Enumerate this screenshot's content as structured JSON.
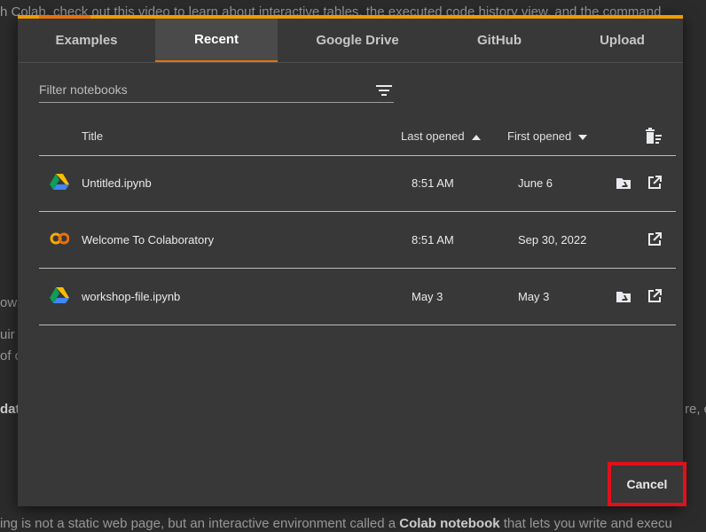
{
  "background": {
    "top_text": "h Colab, check out this video to learn about interactive tables, the executed code history view, and the command",
    "fragments": [
      "ows",
      "uir",
      "of c",
      "dat",
      "re, c"
    ],
    "bottom_text_pre": "ing is not a static web page, but an interactive environment called a ",
    "bottom_text_bold": "Colab notebook",
    "bottom_text_post": " that lets you write and execu"
  },
  "dialog": {
    "tabs": [
      "Examples",
      "Recent",
      "Google Drive",
      "GitHub",
      "Upload"
    ],
    "active_tab": "Recent",
    "filter_placeholder": "Filter notebooks",
    "table": {
      "headers": {
        "title": "Title",
        "last_opened": "Last opened",
        "first_opened": "First opened"
      },
      "rows": [
        {
          "icon": "google-drive-icon",
          "title": "Untitled.ipynb",
          "last_opened": "8:51 AM",
          "first_opened": "June 6",
          "drive_action": true
        },
        {
          "icon": "colab-logo-icon",
          "title": "Welcome To Colaboratory",
          "last_opened": "8:51 AM",
          "first_opened": "Sep 30, 2022",
          "drive_action": false
        },
        {
          "icon": "google-drive-icon",
          "title": "workshop-file.ipynb",
          "last_opened": "May 3",
          "first_opened": "May 3",
          "drive_action": true
        }
      ]
    },
    "cancel_label": "Cancel"
  },
  "colors": {
    "accent": "#e8710a",
    "highlight": "#e0101c",
    "dialog_bg": "#383838"
  }
}
